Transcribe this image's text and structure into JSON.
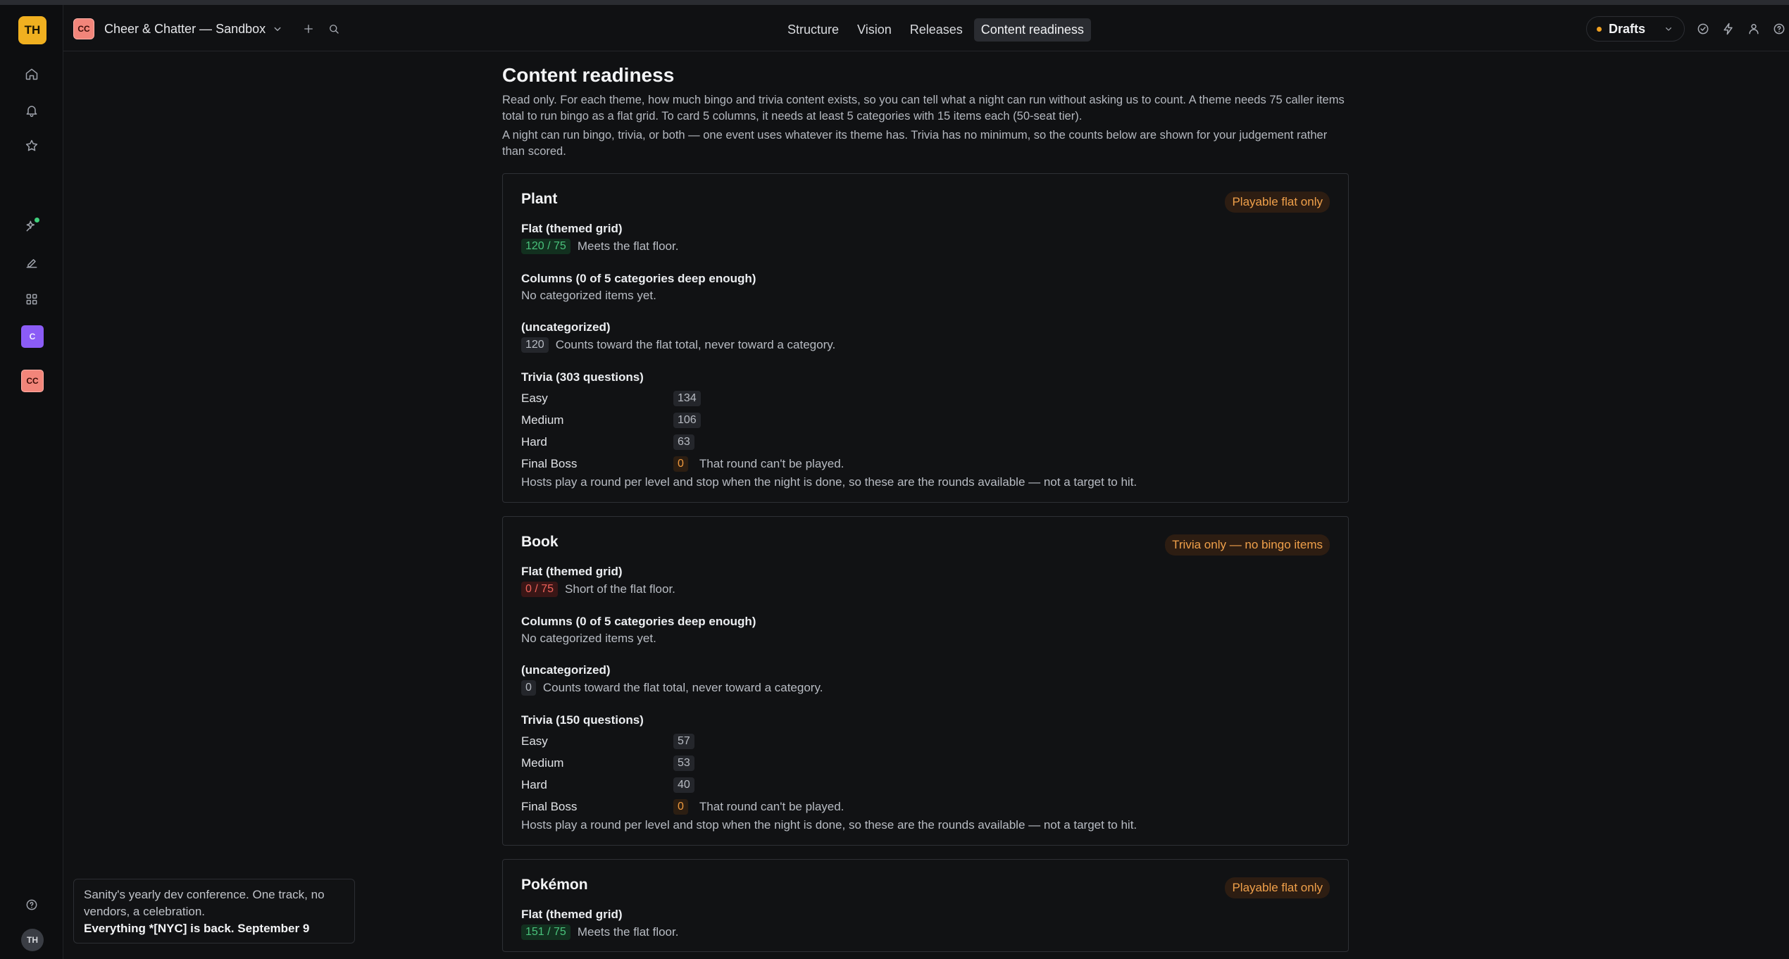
{
  "user": {
    "initials": "TH"
  },
  "project": {
    "logo": "CC",
    "name": "Cheer & Chatter — Sandbox"
  },
  "sidebar": {
    "badge_c": "C",
    "badge_cc": "CC",
    "bottom_initials": "TH"
  },
  "nav": {
    "tabs": [
      "Structure",
      "Vision",
      "Releases",
      "Content readiness"
    ],
    "active": "Content readiness"
  },
  "drafts_label": "Drafts",
  "page": {
    "title": "Content readiness",
    "intro1": "Read only. For each theme, how much bingo and trivia content exists, so you can tell what a night can run without asking us to count. A theme needs 75 caller items total to run bingo as a flat grid. To card 5 columns, it needs at least 5 categories with 15 items each (50-seat tier).",
    "intro2": "A night can run bingo, trivia, or both — one event uses whatever its theme has. Trivia has no minimum, so the counts below are shown for your judgement rather than scored."
  },
  "cards": [
    {
      "name": "Plant",
      "badge": "Playable flat only",
      "flat_title": "Flat (themed grid)",
      "flat_count": "120 / 75",
      "flat_status": "ok",
      "flat_note": "Meets the flat floor.",
      "columns_title": "Columns (0 of 5 categories deep enough)",
      "columns_note": "No categorized items yet.",
      "uncat_title": "(uncategorized)",
      "uncat_count": "120",
      "uncat_note": "Counts toward the flat total, never toward a category.",
      "trivia_title": "Trivia (303 questions)",
      "trivia": [
        {
          "label": "Easy",
          "count": "134"
        },
        {
          "label": "Medium",
          "count": "106"
        },
        {
          "label": "Hard",
          "count": "63"
        },
        {
          "label": "Final Boss",
          "count": "0",
          "note": "That round can't be played."
        }
      ],
      "footer": "Hosts play a round per level and stop when the night is done, so these are the rounds available — not a target to hit."
    },
    {
      "name": "Book",
      "badge": "Trivia only — no bingo items",
      "flat_title": "Flat (themed grid)",
      "flat_count": "0 / 75",
      "flat_status": "short",
      "flat_note": "Short of the flat floor.",
      "columns_title": "Columns (0 of 5 categories deep enough)",
      "columns_note": "No categorized items yet.",
      "uncat_title": "(uncategorized)",
      "uncat_count": "0",
      "uncat_note": "Counts toward the flat total, never toward a category.",
      "trivia_title": "Trivia (150 questions)",
      "trivia": [
        {
          "label": "Easy",
          "count": "57"
        },
        {
          "label": "Medium",
          "count": "53"
        },
        {
          "label": "Hard",
          "count": "40"
        },
        {
          "label": "Final Boss",
          "count": "0",
          "note": "That round can't be played."
        }
      ],
      "footer": "Hosts play a round per level and stop when the night is done, so these are the rounds available — not a target to hit."
    },
    {
      "name": "Pokémon",
      "badge": "Playable flat only",
      "flat_title": "Flat (themed grid)",
      "flat_count": "151 / 75",
      "flat_status": "ok",
      "flat_note": "Meets the flat floor."
    }
  ],
  "toast": {
    "line1": "Sanity's yearly dev conference. One track, no vendors, a celebration.",
    "line2": "Everything *[NYC] is back. September 9"
  },
  "colors": {
    "accent_green": "#49c27b",
    "accent_red": "#f0625a",
    "accent_orange": "#f09a3e",
    "avatar": "#f0b020"
  }
}
